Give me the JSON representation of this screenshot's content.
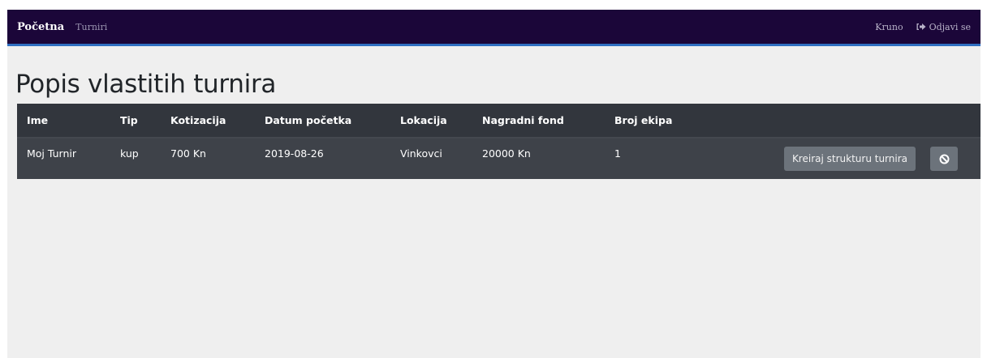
{
  "navbar": {
    "brand": "Početna",
    "link_tournaments": "Turniri",
    "user": "Kruno",
    "logout": "Odjavi se"
  },
  "page_title": "Popis vlastitih turnira",
  "table": {
    "headers": [
      "Ime",
      "Tip",
      "Kotizacija",
      "Datum početka",
      "Lokacija",
      "Nagradni fond",
      "Broj ekipa"
    ],
    "rows": [
      {
        "name": "Moj Turnir",
        "type": "kup",
        "fee": "700 Kn",
        "start_date": "2019-08-26",
        "location": "Vinkovci",
        "prize_fund": "20000 Kn",
        "teams": "1",
        "create_button": "Kreiraj strukturu turnira"
      }
    ]
  },
  "icons": {
    "logout": "sign-out-icon",
    "cancel": "ban-icon"
  },
  "colors": {
    "navbar_bg": "#1b0639",
    "navbar_border": "#2f6fc1",
    "table_header_bg": "#32363d",
    "table_row_bg": "#3e4249",
    "button_bg": "#6c737b"
  }
}
